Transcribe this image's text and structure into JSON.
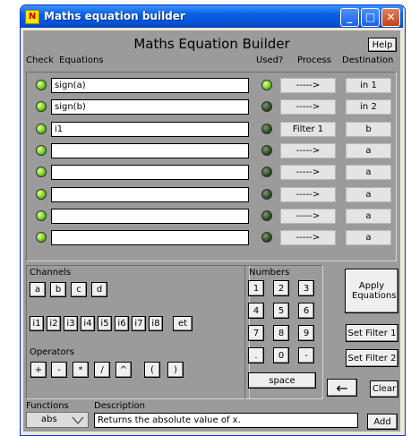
{
  "window": {
    "title": "Maths equation builder",
    "app_icon_glyph": "N",
    "controls": {
      "minimize": "_",
      "maximize": "□",
      "close": "✕"
    }
  },
  "header": {
    "title": "Maths Equation Builder",
    "help_label": "Help",
    "columns": {
      "check": "Check",
      "equations": "Equations",
      "used": "Used?",
      "process": "Process",
      "destination": "Destination"
    }
  },
  "rows": [
    {
      "check_led": "on",
      "equation": "sign(a)",
      "used_led": "on",
      "process": "----->",
      "destination": "in 1"
    },
    {
      "check_led": "on",
      "equation": "sign(b)",
      "used_led": "off",
      "process": "----->",
      "destination": "in 2"
    },
    {
      "check_led": "on",
      "equation": "i1",
      "used_led": "off",
      "process": "Filter 1",
      "destination": "b"
    },
    {
      "check_led": "on",
      "equation": "",
      "used_led": "off",
      "process": "----->",
      "destination": "a"
    },
    {
      "check_led": "on",
      "equation": "",
      "used_led": "off",
      "process": "----->",
      "destination": "a"
    },
    {
      "check_led": "on",
      "equation": "",
      "used_led": "off",
      "process": "----->",
      "destination": "a"
    },
    {
      "check_led": "on",
      "equation": "",
      "used_led": "off",
      "process": "----->",
      "destination": "a"
    },
    {
      "check_led": "on",
      "equation": "",
      "used_led": "off",
      "process": "----->",
      "destination": "a"
    }
  ],
  "channels": {
    "label": "Channels",
    "buttons_row1": [
      "a",
      "b",
      "c",
      "d"
    ],
    "buttons_row2": [
      "i1",
      "i2",
      "i3",
      "i4",
      "i5",
      "i6",
      "i7",
      "i8",
      "et"
    ]
  },
  "operators": {
    "label": "Operators",
    "buttons": [
      "+",
      "-",
      "*",
      "/",
      "^",
      "(",
      ")"
    ]
  },
  "numbers": {
    "label": "Numbers",
    "buttons": [
      "1",
      "2",
      "3",
      "4",
      "5",
      "6",
      "7",
      "8",
      "9",
      ".",
      "0",
      "-"
    ],
    "space_label": "space"
  },
  "actions": {
    "apply_label": "Apply Equations",
    "set_filter1_label": "Set Filter 1",
    "set_filter2_label": "Set Filter 2",
    "backspace_glyph": "←",
    "clear_label": "Clear"
  },
  "bottom": {
    "functions_label": "Functions",
    "description_label": "Description",
    "function_selected": "abs",
    "description_text": "Returns the absolute value of x.",
    "add_label": "Add"
  },
  "colors": {
    "titlebar": "#0a5fe4",
    "panel": "#9b9b9b",
    "led_on": "#6fcf1b",
    "led_off": "#2b4a24"
  }
}
